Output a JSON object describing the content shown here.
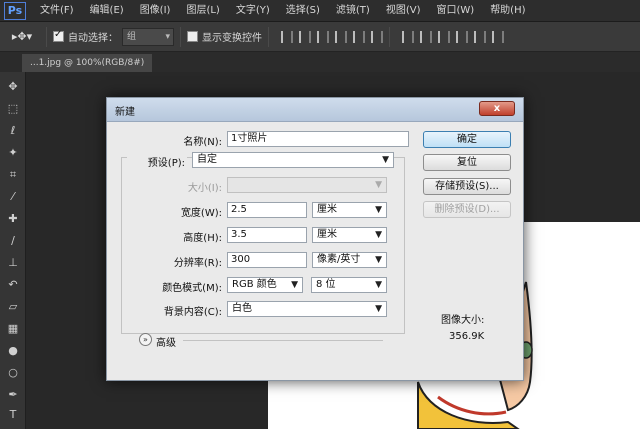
{
  "app": {
    "logo": "Ps"
  },
  "menu": [
    "文件(F)",
    "编辑(E)",
    "图像(I)",
    "图层(L)",
    "文字(Y)",
    "选择(S)",
    "滤镜(T)",
    "视图(V)",
    "窗口(W)",
    "帮助(H)"
  ],
  "options_bar": {
    "auto_select_label": "自动选择：",
    "auto_select_checked": true,
    "auto_select_value": "组",
    "show_transform_label": "显示变换控件",
    "show_transform_checked": false
  },
  "document_tab": {
    "title": "...1.jpg @ 100%(RGB/8#)"
  },
  "tools": [
    "move-tool",
    "marquee-tool",
    "lasso-tool",
    "magic-wand-tool",
    "crop-tool",
    "eyedropper-tool",
    "healing-brush-tool",
    "brush-tool",
    "clone-stamp-tool",
    "history-brush-tool",
    "eraser-tool",
    "gradient-tool",
    "blur-tool",
    "dodge-tool",
    "pen-tool",
    "type-tool"
  ],
  "dialog": {
    "title": "新建",
    "close_label": "x",
    "fields": {
      "name_label": "名称(N):",
      "name_value": "1寸照片",
      "preset_label": "预设(P):",
      "preset_value": "自定",
      "size_label": "大小(I):",
      "size_value": "",
      "width_label": "宽度(W):",
      "width_value": "2.5",
      "width_unit": "厘米",
      "height_label": "高度(H):",
      "height_value": "3.5",
      "height_unit": "厘米",
      "resolution_label": "分辨率(R):",
      "resolution_value": "300",
      "resolution_unit": "像素/英寸",
      "color_mode_label": "颜色模式(M):",
      "color_mode_value": "RGB 颜色",
      "bit_depth_value": "8 位",
      "background_label": "背景内容(C):",
      "background_value": "白色"
    },
    "advanced_label": "高级",
    "buttons": {
      "ok": "确定",
      "reset": "复位",
      "save_preset": "存储预设(S)...",
      "delete_preset": "删除预设(D)..."
    },
    "image_size_label": "图像大小:",
    "image_size_value": "356.9K"
  }
}
